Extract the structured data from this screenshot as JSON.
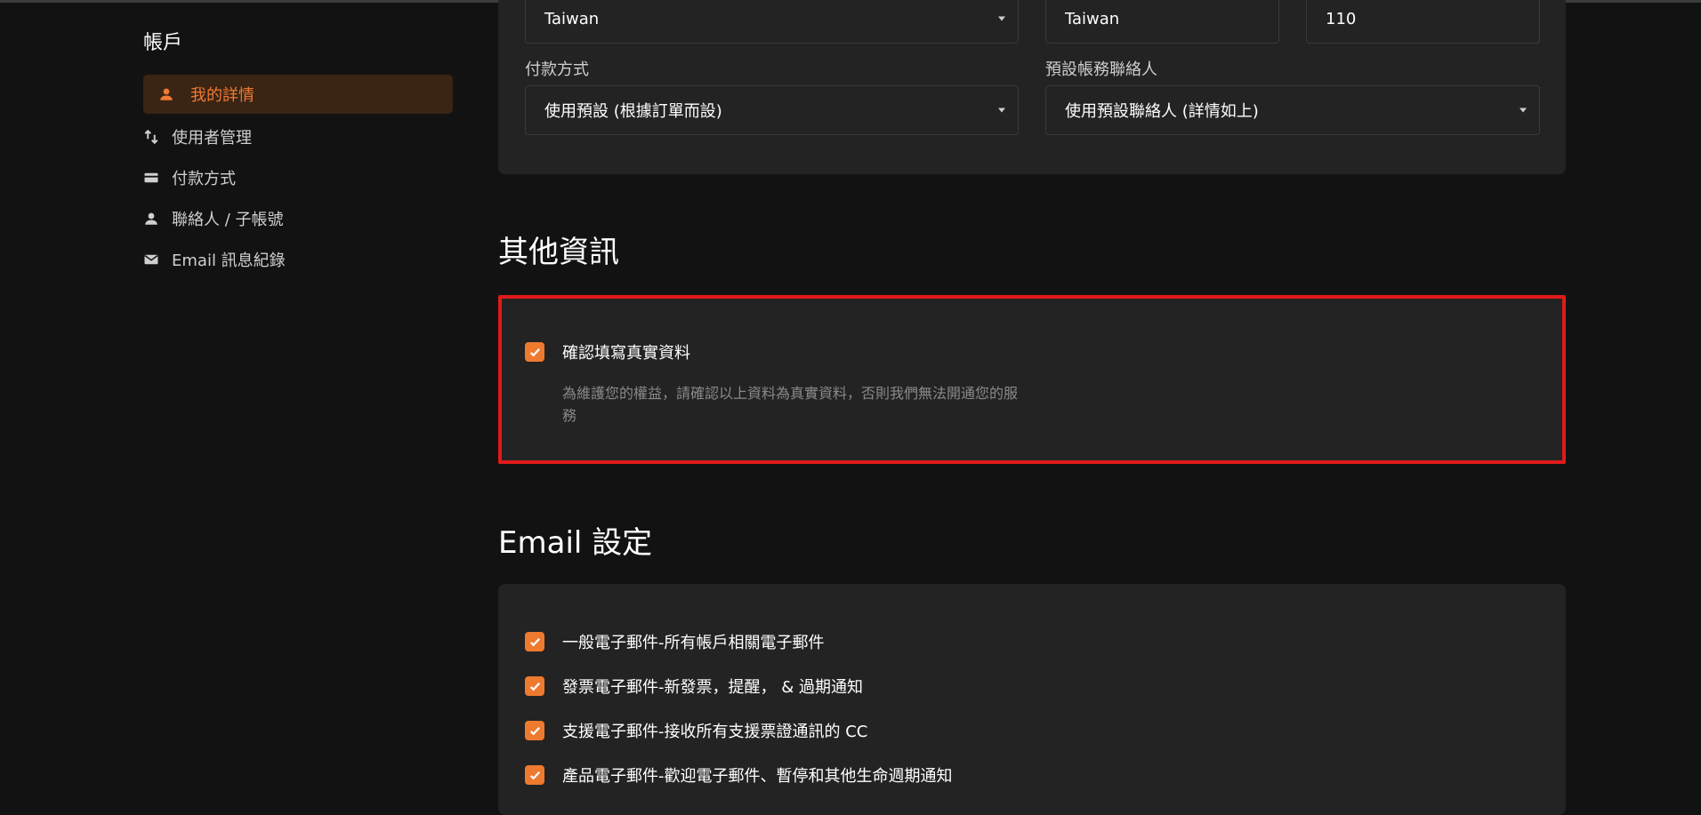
{
  "sidebar": {
    "title": "帳戶",
    "items": [
      {
        "label": "我的詳情",
        "icon": "person-icon",
        "active": true
      },
      {
        "label": "使用者管理",
        "icon": "user-admin-icon",
        "active": false
      },
      {
        "label": "付款方式",
        "icon": "credit-card-icon",
        "active": false
      },
      {
        "label": "聯絡人 / 子帳號",
        "icon": "person-icon",
        "active": false
      },
      {
        "label": "Email 訊息紀錄",
        "icon": "mail-icon",
        "active": false
      }
    ]
  },
  "address": {
    "country_value": "Taiwan",
    "city_value": "Taiwan",
    "postal_value": "110"
  },
  "billing": {
    "payment_label": "付款方式",
    "payment_value": "使用預設 (根據訂單而設)",
    "contact_label": "預設帳務聯絡人",
    "contact_value": "使用預設聯絡人 (詳情如上)"
  },
  "other_info": {
    "title": "其他資訊",
    "confirm_label": "確認填寫真實資料",
    "confirm_checked": true,
    "confirm_desc": "為維護您的權益，請確認以上資料為真實資料，否則我們無法開通您的服務"
  },
  "email_settings": {
    "title": "Email 設定",
    "items": [
      {
        "label": "一般電子郵件-所有帳戶相關電子郵件",
        "checked": true
      },
      {
        "label": "發票電子郵件-新發票，提醒， & 過期通知",
        "checked": true
      },
      {
        "label": "支援電子郵件-接收所有支援票證通訊的 CC",
        "checked": true
      },
      {
        "label": "產品電子郵件-歡迎電子郵件、暫停和其他生命週期通知",
        "checked": true
      }
    ]
  },
  "colors": {
    "accent": "#ee7a30",
    "highlight_border": "#e01a1a",
    "background": "#121212",
    "card": "#232323"
  }
}
